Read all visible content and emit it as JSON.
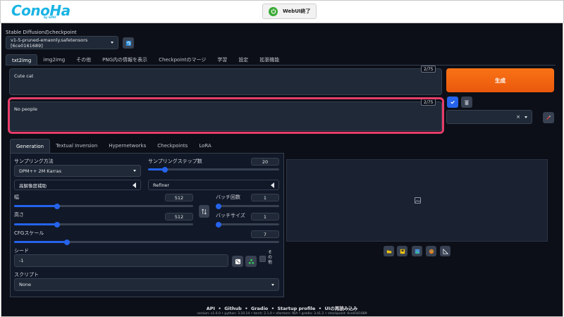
{
  "header": {
    "logo_text": "ConoHa",
    "logo_sub": "by GMO",
    "finish_button": "WebUI終了"
  },
  "checkpoint": {
    "label": "Stable Diffusionのcheckpoint",
    "value": "v1-5-pruned-emaonly.safetensors [6ce0161689]"
  },
  "tabs": [
    "txt2img",
    "img2img",
    "その他",
    "PNG内の情報を表示",
    "Checkpointのマージ",
    "学習",
    "設定",
    "拡張機能"
  ],
  "prompt": {
    "positive": "Cute cat",
    "positive_counter": "2/75",
    "negative": "No people",
    "negative_counter": "2/75"
  },
  "generate_button": "生成",
  "subtabs": [
    "Generation",
    "Textual Inversion",
    "Hypernetworks",
    "Checkpoints",
    "LoRA"
  ],
  "generation": {
    "sampler_label": "サンプリング方法",
    "sampler_value": "DPM++ 2M Karras",
    "steps_label": "サンプリングステップ数",
    "steps_value": "20",
    "steps_fraction": 0.13,
    "hires_label": "高解像度補助",
    "refiner_label": "Refiner",
    "width_label": "幅",
    "width_value": "512",
    "width_fraction": 0.24,
    "height_label": "高さ",
    "height_value": "512",
    "height_fraction": 0.24,
    "batch_count_label": "バッチ回数",
    "batch_count_value": "1",
    "batch_count_fraction": 0.0,
    "batch_size_label": "バッチサイズ",
    "batch_size_value": "1",
    "batch_size_fraction": 0.0,
    "cfg_label": "CFGスケール",
    "cfg_value": "7",
    "cfg_fraction": 0.2,
    "seed_label": "シード",
    "seed_value": "-1",
    "extra_label": "その他",
    "script_label": "スクリプト",
    "script_value": "None"
  },
  "footer": {
    "links": [
      "API",
      "Github",
      "Gradio",
      "Startup profile",
      "UIの再読み込み"
    ],
    "separator": "•",
    "version_line": "version: v1.6.0  •  python: 3.10.14  •  torch: 2.1.0  •  xformers: N/A  •  gradio: 3.41.2  •  checkpoint: 6ce0161689"
  },
  "colors": {
    "accent_orange": "#ea580c",
    "accent_blue": "#2563eb",
    "background": "#0c0f17",
    "highlight": "#e63d6a",
    "logo": "#19b4e4"
  }
}
